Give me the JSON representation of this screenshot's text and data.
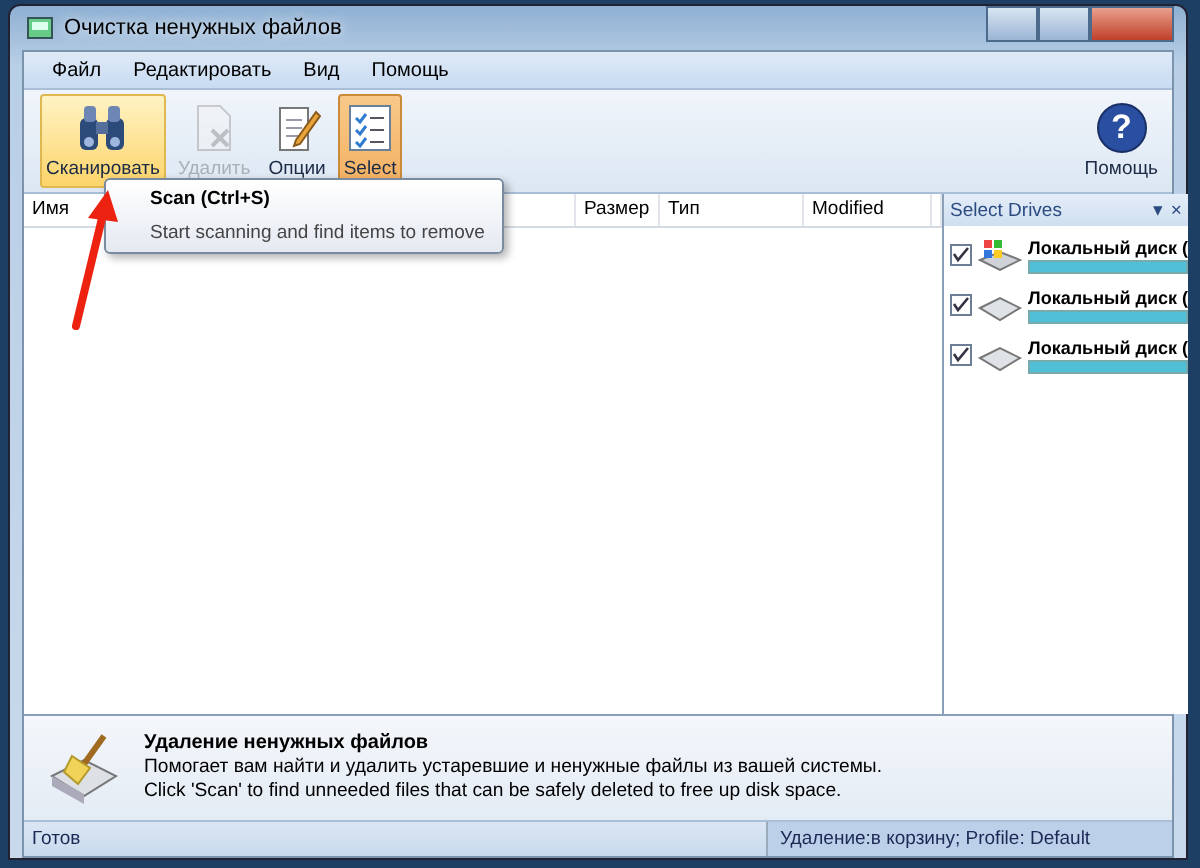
{
  "window": {
    "title": "Очистка ненужных файлов"
  },
  "menu": [
    {
      "label": "Файл"
    },
    {
      "label": "Редактировать"
    },
    {
      "label": "Вид"
    },
    {
      "label": "Помощь"
    }
  ],
  "toolbar": [
    {
      "label": "Сканировать",
      "kind": "scan",
      "highlighted": true,
      "selected": false,
      "disabled": false
    },
    {
      "label": "Удалить",
      "kind": "delete",
      "highlighted": false,
      "selected": false,
      "disabled": true
    },
    {
      "label": "Опции",
      "kind": "options",
      "highlighted": false,
      "selected": false,
      "disabled": false
    },
    {
      "label": "Select",
      "kind": "select",
      "highlighted": false,
      "selected": true,
      "disabled": false
    }
  ],
  "help_button": {
    "glyph": "?",
    "label": "Помощь"
  },
  "tooltip": {
    "title": "Scan (Ctrl+S)",
    "text": "Start scanning and find items to remove"
  },
  "table": {
    "columns": [
      "Имя",
      "Размер",
      "Тип",
      "Modified"
    ]
  },
  "drives_pane": {
    "title": "Select Drives",
    "menu_glyph": "▾",
    "close_glyph": "×",
    "drives": [
      {
        "label": "Локальный диск (",
        "checked": true,
        "kind": "system"
      },
      {
        "label": "Локальный диск (",
        "checked": true,
        "kind": "disk"
      },
      {
        "label": "Локальный диск (",
        "checked": true,
        "kind": "disk"
      }
    ]
  },
  "info": {
    "title": "Удаление ненужных файлов",
    "lines": [
      "Помогает вам найти и удалить устаревшие и ненужные файлы из вашей системы.",
      "Click 'Scan' to find unneeded files that can be safely deleted to free up disk space."
    ]
  },
  "status_bar": {
    "left": "Готов",
    "right": "Удаление:в корзину; Profile: Default"
  }
}
